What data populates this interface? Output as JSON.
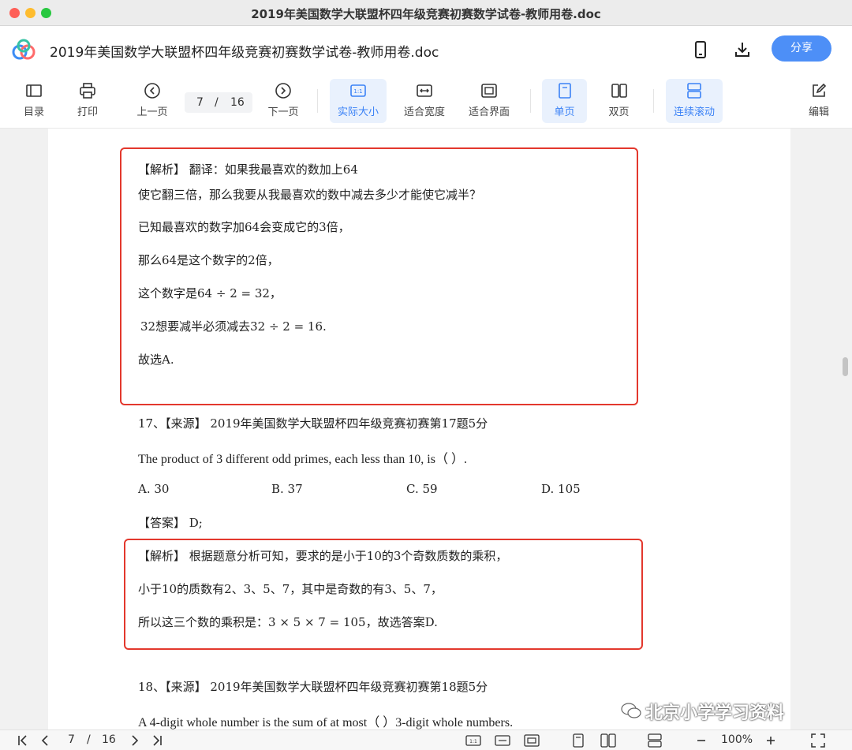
{
  "window": {
    "title": "2019年美国数学大联盟杯四年级竞赛初赛数学试卷-教师用卷.doc"
  },
  "header": {
    "doc_title": "2019年美国数学大联盟杯四年级竞赛初赛数学试卷-教师用卷.doc",
    "share_label": "分享",
    "accent_color": "#4d8ff7"
  },
  "toolbar": {
    "toc": "目录",
    "print": "打印",
    "prev": "上一页",
    "current_page": "7",
    "separator": "/",
    "total_pages": "16",
    "next": "下一页",
    "actual_size": "实际大小",
    "fit_width": "适合宽度",
    "fit_screen": "适合界面",
    "single_page": "单页",
    "double_page": "双页",
    "continuous": "连续滚动",
    "edit": "编辑"
  },
  "document": {
    "box1": [
      "【解析】 翻译：如果我最喜欢的数加上64",
      "使它翻三倍，那么我要从我最喜欢的数中减去多少才能使它减半？",
      "已知最喜欢的数字加64会变成它的3倍，",
      "那么64是这个数字的2倍，",
      "这个数字是64 ÷ 2 = 32，",
      "32想要减半必须减去32 ÷ 2 = 16.",
      "故选A."
    ],
    "q17_source": "17、【来源】 2019年美国数学大联盟杯四年级竞赛初赛第17题5分",
    "q17_text": "The product of 3 different odd primes, each less than 10, is（    ）.",
    "q17_options": [
      "A.  30",
      "B.  37",
      "C.  59",
      "D.  105"
    ],
    "q17_answer": "【答案】 D;",
    "box2": [
      "【解析】 根据题意分析可知，要求的是小于10的3个奇数质数的乘积，",
      "小于10的质数有2、3、5、7，其中是奇数的有3、5、7，",
      "所以这三个数的乘积是：3 × 5 × 7 = 105，故选答案D."
    ],
    "q18_source": "18、【来源】 2019年美国数学大联盟杯四年级竞赛初赛第18题5分",
    "q18_text": "A 4-digit whole number is the sum of at most（    ）3-digit whole numbers.",
    "highlight_color": "#e3382d"
  },
  "watermark": {
    "text": "北京小学学习资料"
  },
  "statusbar": {
    "current_page": "7",
    "separator": "/",
    "total_pages": "16",
    "zoom": "100%"
  }
}
